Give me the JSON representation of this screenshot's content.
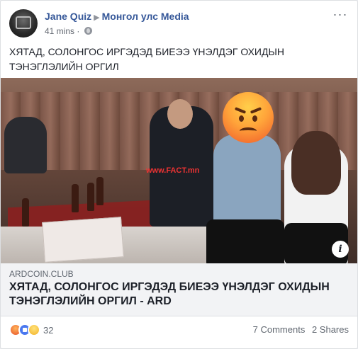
{
  "post": {
    "author": "Jane Quiz",
    "target": "Монгол улс Media",
    "time": "41 mins",
    "text": "ХЯТАД, СОЛОНГОС ИРГЭДЭД БИЕЭЭ ҮНЭЛДЭГ ОХИДЫН ТЭНЭГЛЭЛИЙН ОРГИЛ"
  },
  "image": {
    "watermark": "www.FACT.mn",
    "overlay_icon": "angry-face-emoji-icon"
  },
  "link": {
    "domain": "ARDCOIN.CLUB",
    "title": "ХЯТАД, СОЛОНГОС ИРГЭДЭД БИЕЭЭ ҮНЭЛДЭГ ОХИДЫН ТЭНЭГЛЭЛИЙН ОРГИЛ - ARD"
  },
  "footer": {
    "reactions": [
      "angry-reaction-icon",
      "like-reaction-icon",
      "sad-reaction-icon"
    ],
    "reaction_count": "32",
    "comments": "7 Comments",
    "shares": "2 Shares"
  },
  "colors": {
    "link_blue": "#365899",
    "meta_gray": "#616770",
    "card_bg": "#ffffff",
    "page_bg": "#e9ebee"
  }
}
